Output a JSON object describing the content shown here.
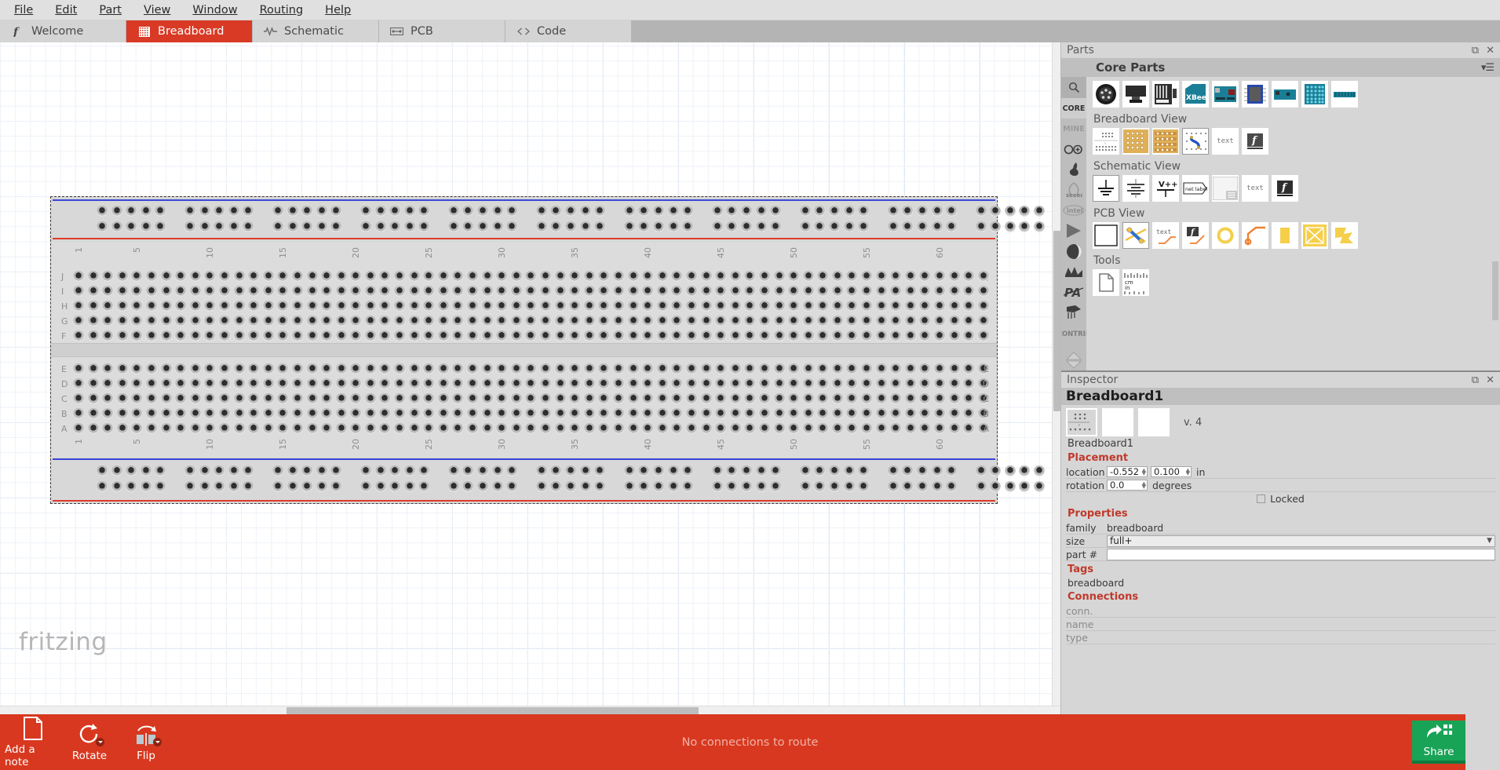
{
  "menubar": {
    "items": [
      {
        "label": "File"
      },
      {
        "label": "Edit"
      },
      {
        "label": "Part"
      },
      {
        "label": "View"
      },
      {
        "label": "Window"
      },
      {
        "label": "Routing"
      },
      {
        "label": "Help"
      }
    ]
  },
  "tabs": [
    {
      "label": "Welcome",
      "icon": "fritzing-f-icon",
      "active": false
    },
    {
      "label": "Breadboard",
      "icon": "breadboard-grid-icon",
      "active": true
    },
    {
      "label": "Schematic",
      "icon": "waveform-icon",
      "active": false
    },
    {
      "label": "PCB",
      "icon": "pcb-chip-icon",
      "active": false
    },
    {
      "label": "Code",
      "icon": "angle-brackets-icon",
      "active": false
    }
  ],
  "canvas": {
    "watermark": "fritzing",
    "breadboard": {
      "column_numbers": [
        1,
        5,
        10,
        15,
        20,
        25,
        30,
        35,
        40,
        45,
        50,
        55,
        60
      ],
      "top_row_labels": [
        "J",
        "I",
        "H",
        "G",
        "F"
      ],
      "bottom_row_labels": [
        "E",
        "D",
        "C",
        "B",
        "A"
      ],
      "columns": 63,
      "rail_colors": {
        "positive": "#e03a2a",
        "negative": "#3a46d8"
      }
    }
  },
  "parts_panel": {
    "title": "Parts",
    "header": "Core Parts",
    "bins": [
      {
        "label": "",
        "icon": "search-icon"
      },
      {
        "label": "CORE",
        "icon": "core-bin-icon"
      },
      {
        "label": "MINE",
        "icon": "mine-bin-icon"
      },
      {
        "label": "",
        "icon": "arduino-infinity-icon"
      },
      {
        "label": "",
        "icon": "sparkfun-flame-icon"
      },
      {
        "label": "seeed",
        "icon": "seeed-icon"
      },
      {
        "label": "intel",
        "icon": "intel-icon"
      },
      {
        "label": "",
        "icon": "play-triangle-icon"
      },
      {
        "label": "",
        "icon": "moon-phase-icon"
      },
      {
        "label": "",
        "icon": "snootlab-icon"
      },
      {
        "label": "PA",
        "icon": "parallax-icon"
      },
      {
        "label": "",
        "icon": "picaxe-icon"
      },
      {
        "label": "CONTRIB",
        "icon": "contrib-icon"
      }
    ],
    "sections": [
      {
        "label": "",
        "parts": [
          {
            "name": "din-connector-part",
            "icon": "din-connector"
          },
          {
            "name": "lcd-display-part",
            "icon": "lcd-display"
          },
          {
            "name": "shield-board-part",
            "icon": "shield-board"
          },
          {
            "name": "xbee-part",
            "icon": "xbee",
            "text": "XBee"
          },
          {
            "name": "arduino-board-part",
            "icon": "arduino-board"
          },
          {
            "name": "ic-chip-part",
            "icon": "ic-chip"
          },
          {
            "name": "arduino-nano-part",
            "icon": "arduino-nano"
          },
          {
            "name": "led-matrix-part",
            "icon": "led-matrix"
          },
          {
            "name": "header-strip-part",
            "icon": "header-strip"
          }
        ]
      },
      {
        "label": "Breadboard View",
        "parts": [
          {
            "name": "breadboard-part",
            "icon": "breadboard-mini"
          },
          {
            "name": "perfboard-part",
            "icon": "perfboard"
          },
          {
            "name": "stripboard-part",
            "icon": "stripboard"
          },
          {
            "name": "wire-part",
            "icon": "blue-wire"
          },
          {
            "name": "text-part",
            "icon": "text-glyph",
            "text": "text"
          },
          {
            "name": "logo-part",
            "icon": "fritzing-logo"
          }
        ]
      },
      {
        "label": "Schematic View",
        "parts": [
          {
            "name": "ground-symbol-part",
            "icon": "ground-symbol"
          },
          {
            "name": "battery-symbol-part",
            "icon": "battery-symbol"
          },
          {
            "name": "power-symbol-part",
            "icon": "vplusplus-symbol",
            "text": "V++"
          },
          {
            "name": "net-label-part",
            "icon": "net-label",
            "text": "net label"
          },
          {
            "name": "schematic-frame-part",
            "icon": "schematic-frame"
          },
          {
            "name": "schematic-text-part",
            "icon": "text-glyph",
            "text": "text"
          },
          {
            "name": "schematic-logo-part",
            "icon": "fritzing-logo"
          }
        ]
      },
      {
        "label": "PCB View",
        "parts": [
          {
            "name": "pcb-board-part",
            "icon": "blank-board"
          },
          {
            "name": "via-jumper-part",
            "icon": "via-jumper"
          },
          {
            "name": "pcb-text-part",
            "icon": "pcb-text",
            "text": "text"
          },
          {
            "name": "pcb-logo-part",
            "icon": "pcb-logo"
          },
          {
            "name": "hole-part",
            "icon": "ring-hole"
          },
          {
            "name": "pad-trace-part",
            "icon": "pad-trace"
          },
          {
            "name": "copper-fill-part",
            "icon": "copper-pad"
          },
          {
            "name": "copper-blocker-part",
            "icon": "copper-blocker"
          },
          {
            "name": "copper-shape-part",
            "icon": "copper-shape"
          }
        ]
      },
      {
        "label": "Tools",
        "parts": [
          {
            "name": "note-part",
            "icon": "note-page"
          },
          {
            "name": "ruler-part",
            "icon": "ruler",
            "text": "cm in"
          }
        ]
      }
    ]
  },
  "inspector": {
    "title": "Inspector",
    "part_name": "Breadboard1",
    "version": "v. 4",
    "subtitle": "Breadboard1",
    "placement": {
      "label": "Placement",
      "location_label": "location",
      "location_x": "-0.552",
      "location_y": "0.100",
      "location_unit": "in",
      "rotation_label": "rotation",
      "rotation_value": "0.0",
      "rotation_unit": "degrees",
      "locked_label": "Locked"
    },
    "properties": {
      "label": "Properties",
      "rows": [
        {
          "key": "family",
          "value": "breadboard",
          "type": "static"
        },
        {
          "key": "size",
          "value": "full+",
          "type": "select"
        },
        {
          "key": "part #",
          "value": "",
          "type": "text"
        }
      ]
    },
    "tags": {
      "label": "Tags",
      "values": [
        "breadboard"
      ]
    },
    "connections": {
      "label": "Connections",
      "rows": [
        {
          "key": "conn.",
          "value": ""
        },
        {
          "key": "name",
          "value": ""
        },
        {
          "key": "type",
          "value": ""
        }
      ]
    }
  },
  "bottom_toolbar": {
    "tools": [
      {
        "label": "Add a note",
        "icon": "note-icon",
        "has_menu": false
      },
      {
        "label": "Rotate",
        "icon": "rotate-icon",
        "has_menu": true
      },
      {
        "label": "Flip",
        "icon": "flip-icon",
        "has_menu": true
      }
    ],
    "status": "No connections to route",
    "share_label": "Share"
  },
  "colors": {
    "accent_red": "#d8381f",
    "share_green": "#19a357",
    "section_red": "#c0392b"
  }
}
